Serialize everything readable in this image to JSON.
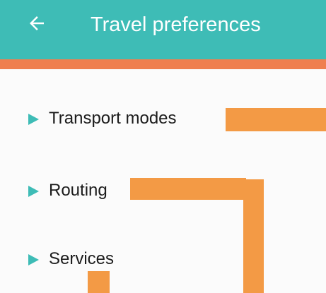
{
  "app_bar": {
    "title": "Travel preferences",
    "back_icon": "arrow-left-icon"
  },
  "preferences": {
    "items": [
      {
        "label": "Transport modes",
        "icon": "expand-triangle-icon"
      },
      {
        "label": "Routing",
        "icon": "expand-triangle-icon"
      },
      {
        "label": "Services",
        "icon": "expand-triangle-icon"
      }
    ]
  },
  "colors": {
    "app_bar": "#3ebcb6",
    "accent_bar": "#ef7f4f",
    "arrow": "#3ebcb6",
    "text": "#1c1c1c",
    "background": "#fbfbfb",
    "redaction": "#f39a45"
  }
}
